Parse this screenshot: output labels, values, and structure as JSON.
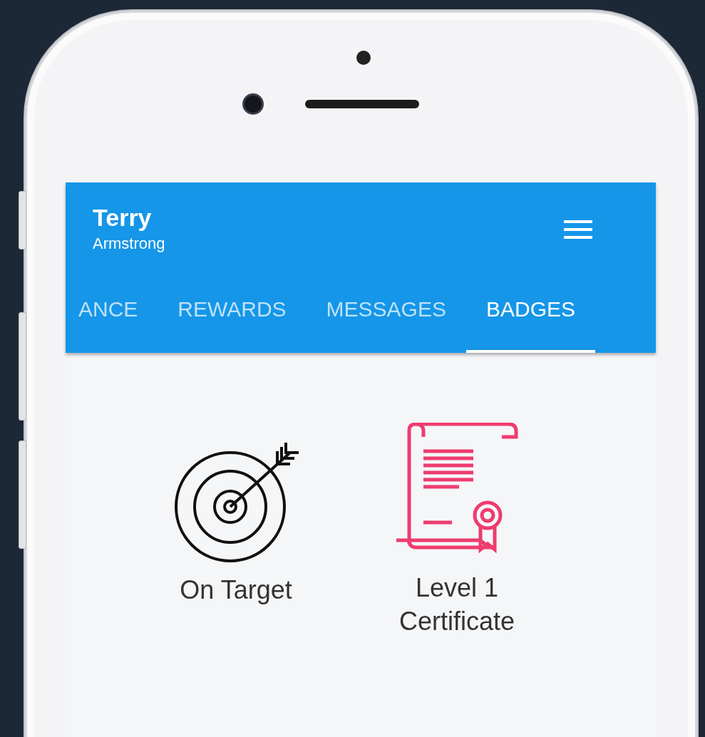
{
  "header": {
    "first_name": "Terry",
    "last_name": "Armstrong"
  },
  "tabs": [
    {
      "label": "ANCE",
      "selected": false
    },
    {
      "label": "REWARDS",
      "selected": false
    },
    {
      "label": "MESSAGES",
      "selected": false
    },
    {
      "label": "BADGES",
      "selected": true
    }
  ],
  "badges": [
    {
      "kind": "target",
      "label": "On Target"
    },
    {
      "kind": "certificate",
      "label": "Level 1 Certificate"
    }
  ]
}
